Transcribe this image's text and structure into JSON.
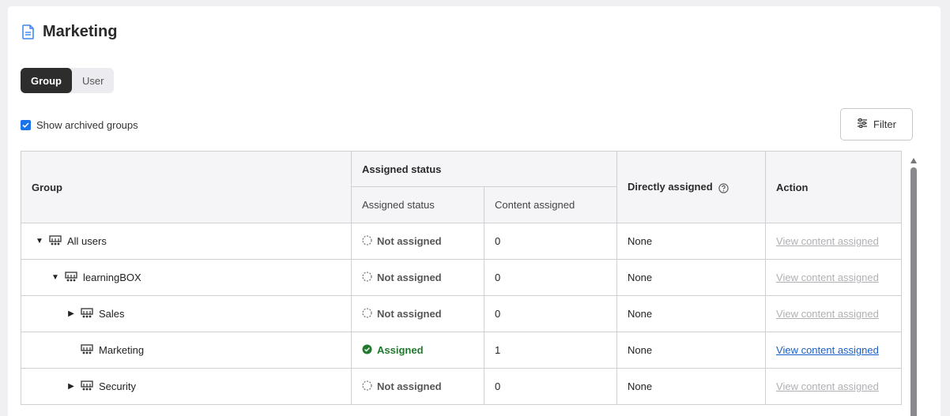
{
  "page": {
    "title": "Marketing",
    "icon": "document-icon"
  },
  "tabs": [
    {
      "label": "Group",
      "active": true
    },
    {
      "label": "User",
      "active": false
    }
  ],
  "archived": {
    "label": "Show archived groups",
    "checked": true
  },
  "filter": {
    "label": "Filter",
    "icon": "sliders-icon"
  },
  "table": {
    "headers": {
      "group": "Group",
      "assigned_status_group": "Assigned status",
      "assigned_status": "Assigned status",
      "content_assigned": "Content assigned",
      "directly_assigned": "Directly assigned",
      "action": "Action"
    },
    "rows": [
      {
        "name": "All users",
        "caret": "▼",
        "status": "Not assigned",
        "assigned": false,
        "content": "0",
        "direct": "None",
        "action": "View content assigned"
      },
      {
        "name": "learningBOX",
        "caret": "▼",
        "status": "Not assigned",
        "assigned": false,
        "content": "0",
        "direct": "None",
        "action": "View content assigned"
      },
      {
        "name": "Sales",
        "caret": "▶",
        "status": "Not assigned",
        "assigned": false,
        "content": "0",
        "direct": "None",
        "action": "View content assigned"
      },
      {
        "name": "Marketing",
        "caret": "",
        "status": "Assigned",
        "assigned": true,
        "content": "1",
        "direct": "None",
        "action": "View content assigned"
      },
      {
        "name": "Security",
        "caret": "▶",
        "status": "Not assigned",
        "assigned": false,
        "content": "0",
        "direct": "None",
        "action": "View content assigned"
      }
    ]
  },
  "colors": {
    "accent": "#1a73e8",
    "assigned": "#1f7a2e",
    "link": "#1a5fc7",
    "link_disabled": "#b0b0b4"
  }
}
